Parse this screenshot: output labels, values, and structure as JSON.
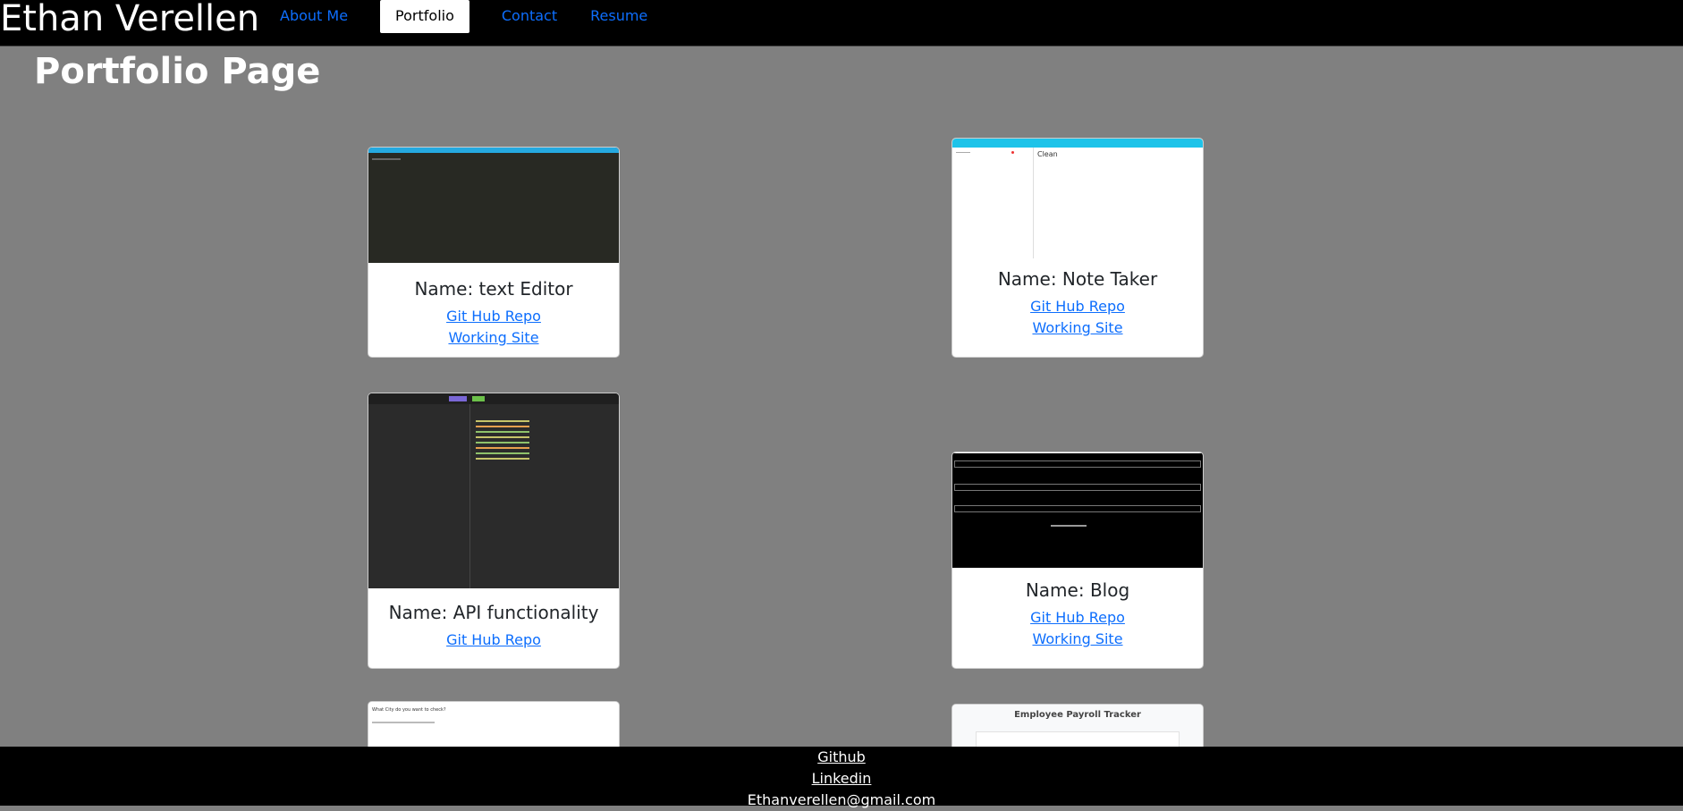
{
  "header": {
    "brand": "Ethan Verellen",
    "nav": [
      {
        "label": "About Me",
        "active": false
      },
      {
        "label": "Portfolio",
        "active": true
      },
      {
        "label": "Contact",
        "active": false
      },
      {
        "label": "Resume",
        "active": false
      }
    ]
  },
  "page_title": "Portfolio Page",
  "projects": [
    {
      "name": "Name: text Editor",
      "repo": "Git Hub Repo",
      "site": "Working Site"
    },
    {
      "name": "Name: Note Taker",
      "repo": "Git Hub Repo",
      "site": "Working Site",
      "thumb_text": "Clean"
    },
    {
      "name": "Name: API functionality",
      "repo": "Git Hub Repo"
    },
    {
      "name": "Name: Blog",
      "repo": "Git Hub Repo",
      "site": "Working Site"
    },
    {
      "thumb_text": "What City do you want to check?"
    },
    {
      "thumb_text": "Employee Payroll Tracker"
    }
  ],
  "footer": {
    "github": "Github",
    "linkedin": "Linkedin",
    "email": "Ethanverellen@gmail.com"
  },
  "colors": {
    "header_bg": "#000000",
    "page_bg": "#808080",
    "link": "#0d6efd"
  }
}
